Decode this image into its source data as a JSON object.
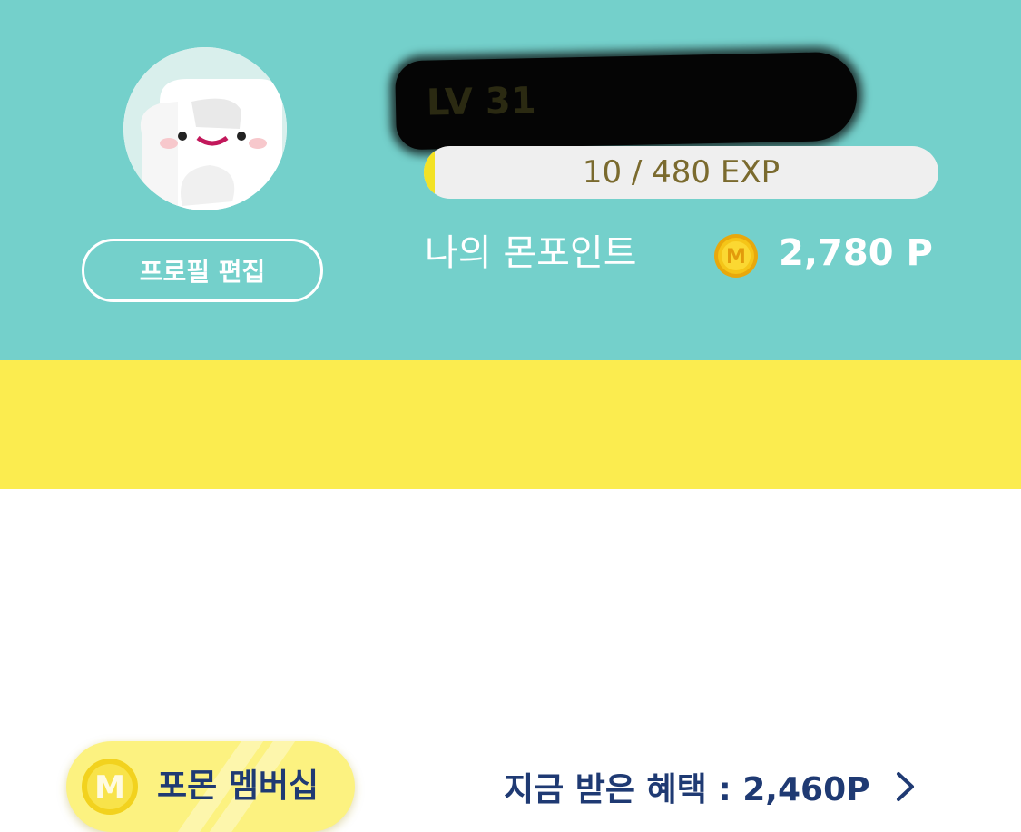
{
  "profile": {
    "edit_label": "프로필 편집",
    "username": "LV 31"
  },
  "exp": {
    "current": 10,
    "max": 480,
    "text": "10 / 480 EXP"
  },
  "points": {
    "label": "나의 몬포인트",
    "coin_letter": "M",
    "value": "2,780 P"
  },
  "membership": {
    "coin_letter": "M",
    "label": "포몬 멤버십",
    "benefit_text": "지금 받은 혜택 : 2,460P",
    "chevron_icon": "chevron-right-icon"
  },
  "colors": {
    "teal_background": "#74d0cb",
    "yellow_background": "#fbec4f",
    "navy_text": "#1f3a73",
    "exp_fill": "#f3e224",
    "coin_gold": "#f5c518"
  }
}
